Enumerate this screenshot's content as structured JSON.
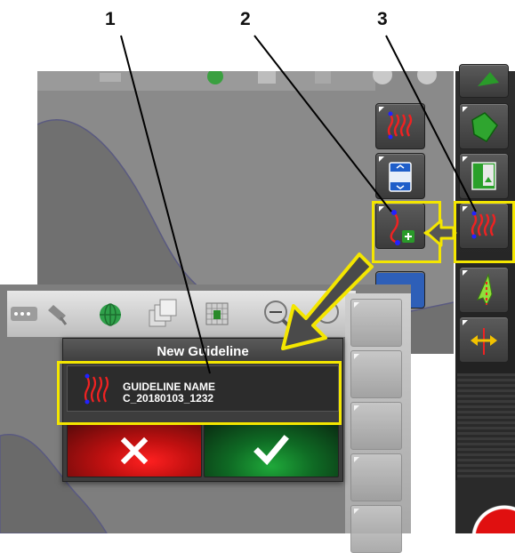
{
  "callouts": [
    "1",
    "2",
    "3"
  ],
  "dialog": {
    "title": "New Guideline",
    "name_label": "GUIDELINE NAME",
    "name_value": "C_20180103_1232",
    "cancel_icon": "close-x-icon",
    "confirm_icon": "checkmark-icon"
  },
  "highlight_color": "#f4e600",
  "icons": {
    "toolbar": [
      "antenna-icon",
      "satellite-dish-icon",
      "globe-icon",
      "layers-icon",
      "grid-map-icon",
      "zoom-out-icon",
      "zoom-in-icon"
    ],
    "background_column": [
      "wavy-lines-icon",
      "scroll-list-icon",
      "new-guideline-icon"
    ],
    "right_rail": [
      "map-view-icon",
      "field-green-icon",
      "field-export-icon",
      "guideline-patterns-icon",
      "steering-icon",
      "nudge-icon",
      "red-stop-button"
    ]
  }
}
